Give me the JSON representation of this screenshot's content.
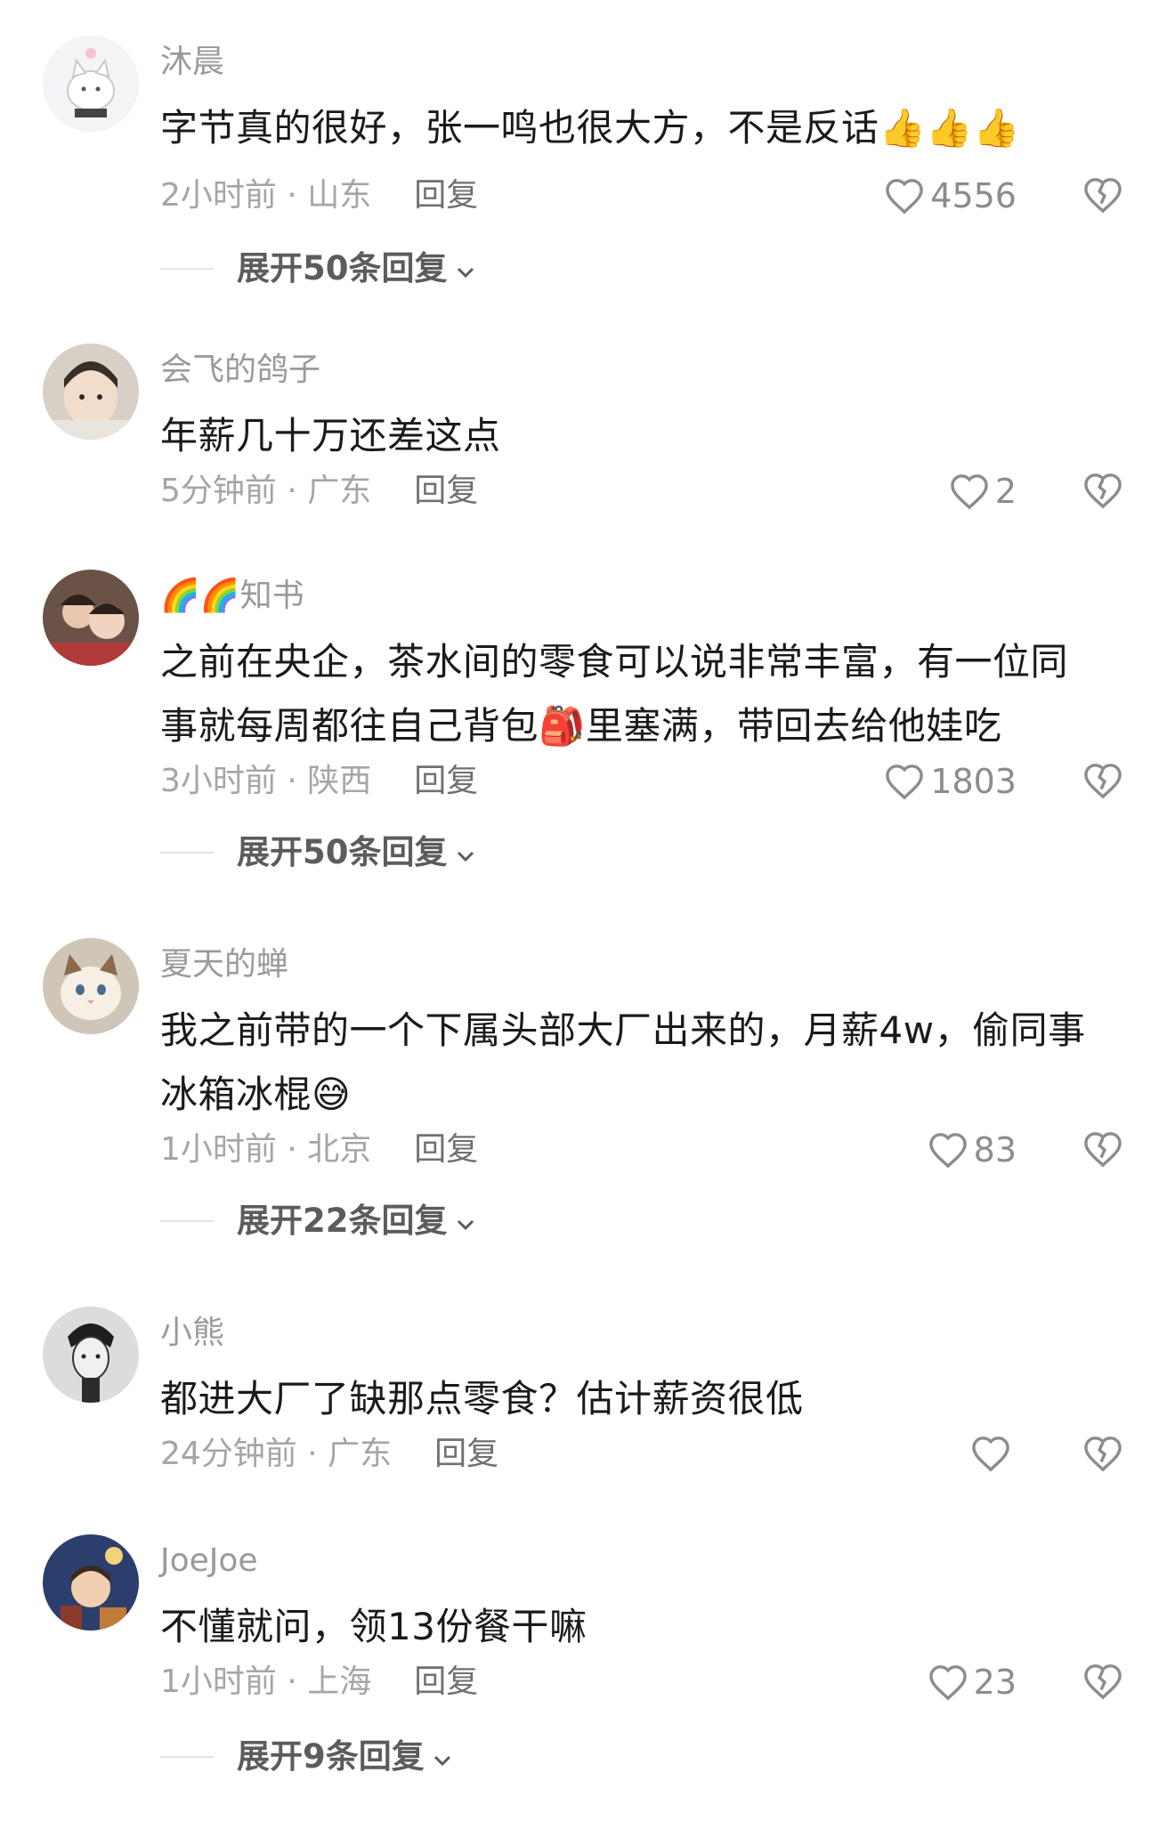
{
  "comments": [
    {
      "username": "沐晨",
      "text": "字节真的很好，张一鸣也很大方，不是反话",
      "text_emoji": "👍👍👍",
      "time": "2小时前 · 山东",
      "reply": "回复",
      "likes": "4556",
      "expand": "展开50条回复"
    },
    {
      "username": "会飞的鸽子",
      "text": "年薪几十万还差这点",
      "time": "5分钟前 · 广东",
      "reply": "回复",
      "likes": "2"
    },
    {
      "username_emoji": "🌈🌈",
      "username": "知书",
      "text_line1": "之前在央企，茶水间的零食可以说非常丰富，有一位同",
      "text_line2a": "事就每周都往自己背包",
      "text_line2_emoji": "🎒",
      "text_line2b": "里塞满，带回去给他娃吃",
      "time": "3小时前 · 陕西",
      "reply": "回复",
      "likes": "1803",
      "expand": "展开50条回复"
    },
    {
      "username": "夏天的蝉",
      "text_line1": "我之前带的一个下属头部大厂出来的，月薪4w，偷同事",
      "text_line2": "冰箱冰棍",
      "text_line2_emoji": "😅",
      "time": "1小时前 · 北京",
      "reply": "回复",
      "likes": "83",
      "expand": "展开22条回复"
    },
    {
      "username": "小熊",
      "text": "都进大厂了缺那点零食？估计薪资很低",
      "time": "24分钟前 · 广东",
      "reply": "回复",
      "likes": ""
    },
    {
      "username": "JoeJoe",
      "text": "不懂就问，领13份餐干嘛",
      "time": "1小时前 · 上海",
      "reply": "回复",
      "likes": "23",
      "expand": "展开9条回复"
    }
  ],
  "icons": {
    "like": "heart-icon",
    "dislike": "broken-heart-icon",
    "expand": "chevron-down-icon"
  },
  "colors": {
    "username": "#9a9a9a",
    "text": "#1a1a1a",
    "meta": "#a5a5a5",
    "icon": "#8c8c8c"
  }
}
